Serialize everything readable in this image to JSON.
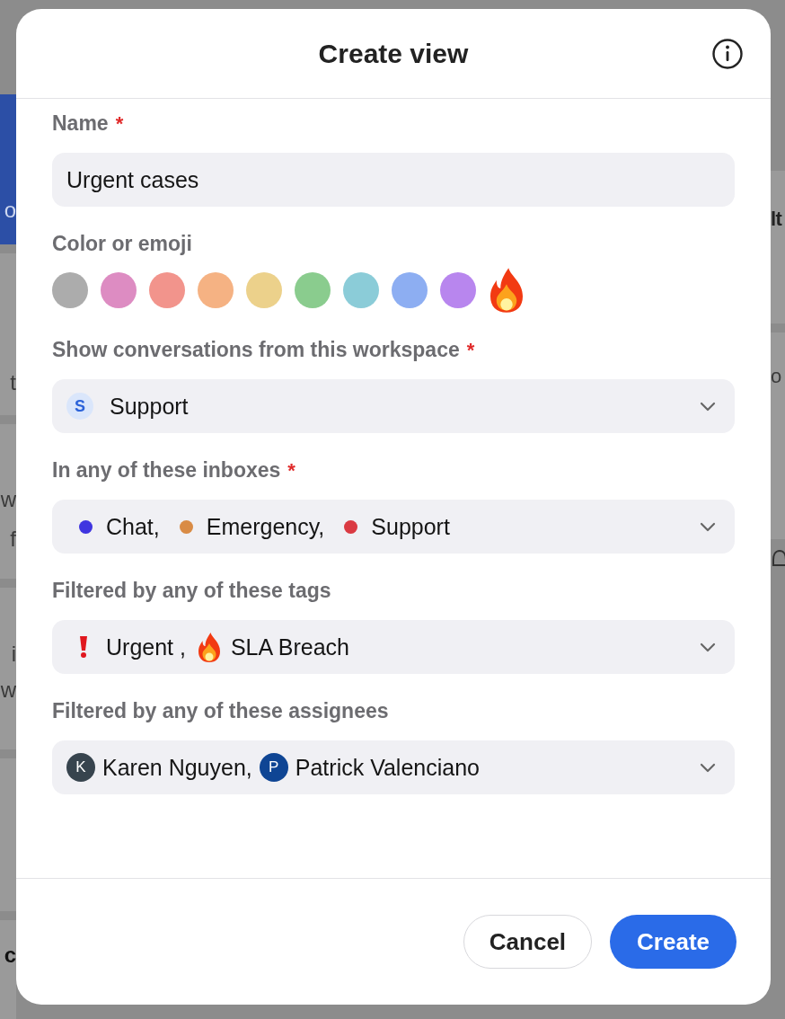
{
  "background": {
    "left": [
      {
        "kind": "blank"
      },
      {
        "kind": "blue",
        "text": "o"
      },
      {
        "kind": "card",
        "lines": [
          "t"
        ]
      },
      {
        "kind": "card",
        "lines": [
          "w",
          "f"
        ]
      },
      {
        "kind": "card",
        "lines": [
          "i",
          "w"
        ]
      },
      {
        "kind": "card"
      },
      {
        "kind": "card",
        "lines": [
          "c"
        ]
      }
    ],
    "right": [
      {
        "kind": "blank"
      },
      {
        "kind": "card",
        "lines": [
          "lt"
        ]
      },
      {
        "kind": "card",
        "lines": [
          "o"
        ]
      },
      {
        "kind": "icon"
      }
    ]
  },
  "dialog": {
    "title": "Create view",
    "fields": [
      {
        "kind": "text",
        "label": "Name",
        "required": true,
        "required_mark": "*",
        "value": "Urgent cases"
      },
      {
        "kind": "colors",
        "label": "Color or emoji",
        "required": false,
        "swatches": [
          {
            "color": "#acacac"
          },
          {
            "color": "#dd8cc2"
          },
          {
            "color": "#f2948c"
          },
          {
            "color": "#f5b283"
          },
          {
            "color": "#ecd18b"
          },
          {
            "color": "#8acc8e"
          },
          {
            "color": "#8bccd8"
          },
          {
            "color": "#8daef2"
          },
          {
            "color": "#b886ee"
          },
          {
            "kind": "emoji"
          }
        ]
      },
      {
        "kind": "workspace",
        "label": "Show conversations from this workspace",
        "required": true,
        "required_mark": "*",
        "badge": "S",
        "value": "Support"
      },
      {
        "kind": "inboxes",
        "label": "In any of these inboxes",
        "required": true,
        "required_mark": "*",
        "items": [
          {
            "text": "Chat,",
            "color": "#3f35e0"
          },
          {
            "text": "Emergency,",
            "color": "#d98b45"
          },
          {
            "text": "Support",
            "color": "#da3a42"
          }
        ]
      },
      {
        "kind": "tags",
        "label": "Filtered by any of these tags",
        "required": false,
        "items": [
          {
            "kind": "exclamation",
            "text": "Urgent ,"
          },
          {
            "kind": "flame",
            "text": "SLA Breach"
          }
        ]
      },
      {
        "kind": "assignees",
        "label": "Filtered by any of these assignees",
        "required": false,
        "items": [
          {
            "initial": "K",
            "text": "Karen Nguyen,",
            "color": "#37444e"
          },
          {
            "initial": "P",
            "text": "Patrick Valenciano",
            "color": "#0f4594"
          }
        ]
      }
    ],
    "buttons": [
      {
        "kind": "secondary",
        "label": "Cancel"
      },
      {
        "kind": "primary",
        "label": "Create"
      }
    ]
  }
}
